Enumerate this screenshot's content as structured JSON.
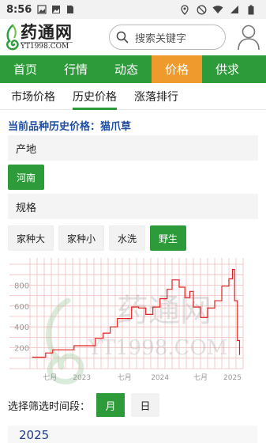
{
  "status": {
    "time": "8:56"
  },
  "header": {
    "logo_cn": "药通网",
    "logo_en": "YT1998.COM",
    "search_placeholder": "搜索关键字"
  },
  "nav": [
    "首页",
    "行情",
    "动态",
    "价格",
    "供求"
  ],
  "subtabs": [
    "市场价格",
    "历史价格",
    "涨落排行"
  ],
  "current_title": "当前品种历史价格：猫爪草",
  "origin": {
    "label": "产地",
    "options": [
      "河南"
    ]
  },
  "spec": {
    "label": "规格",
    "options": [
      "家种大",
      "家种小",
      "水洗",
      "野生"
    ]
  },
  "watermark": {
    "cn": "药通网",
    "en": "YT1998.COM"
  },
  "filter": {
    "label": "选择筛选时间段：",
    "month": "月",
    "day": "日"
  },
  "year_label": "2025",
  "chart_data": {
    "type": "line",
    "color": "#e02020",
    "y_ticks": [
      "800",
      "600",
      "400",
      "200"
    ],
    "ylim": [
      0,
      1000
    ],
    "x_ticks": [
      "七月",
      "2023",
      "七月",
      "2024",
      "七月",
      "2025"
    ],
    "xlim": [
      0,
      30
    ],
    "series": [
      {
        "values": [
          [
            0.3,
            110
          ],
          [
            2.2,
            110
          ],
          [
            2.2,
            150
          ],
          [
            3.2,
            150
          ],
          [
            3.2,
            180
          ],
          [
            6.2,
            180
          ],
          [
            6.2,
            220
          ],
          [
            9.2,
            220
          ],
          [
            9.2,
            290
          ],
          [
            10.3,
            290
          ],
          [
            10.3,
            340
          ],
          [
            11.3,
            340
          ],
          [
            11.3,
            400
          ],
          [
            12.3,
            400
          ],
          [
            12.3,
            480
          ],
          [
            14.3,
            480
          ],
          [
            14.3,
            590
          ],
          [
            15.3,
            590
          ],
          [
            15.3,
            580
          ],
          [
            16.3,
            580
          ],
          [
            16.3,
            520
          ],
          [
            17.3,
            520
          ],
          [
            17.3,
            590
          ],
          [
            18.3,
            590
          ],
          [
            18.3,
            670
          ],
          [
            19.3,
            670
          ],
          [
            19.3,
            760
          ],
          [
            20.0,
            760
          ],
          [
            20.0,
            850
          ],
          [
            21.0,
            850
          ],
          [
            21.0,
            780
          ],
          [
            21.8,
            780
          ],
          [
            21.8,
            680
          ],
          [
            22.5,
            680
          ],
          [
            22.5,
            740
          ],
          [
            23.0,
            740
          ],
          [
            23.0,
            590
          ],
          [
            24.0,
            590
          ],
          [
            24.0,
            490
          ],
          [
            25.0,
            490
          ],
          [
            25.0,
            580
          ],
          [
            26.0,
            580
          ],
          [
            26.0,
            650
          ],
          [
            27.0,
            650
          ],
          [
            27.0,
            790
          ],
          [
            28.0,
            790
          ],
          [
            28.0,
            860
          ],
          [
            28.5,
            860
          ],
          [
            28.5,
            950
          ],
          [
            28.8,
            950
          ],
          [
            28.8,
            650
          ],
          [
            29.2,
            650
          ],
          [
            29.2,
            270
          ],
          [
            29.5,
            270
          ],
          [
            29.5,
            130
          ]
        ]
      }
    ]
  }
}
